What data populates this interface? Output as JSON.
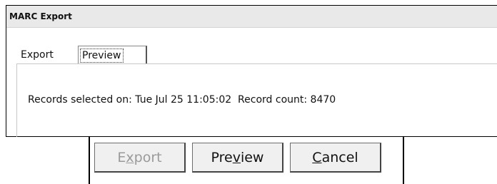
{
  "window": {
    "title": "MARC Export"
  },
  "tabs": [
    {
      "label": "Export",
      "selected": false
    },
    {
      "label": "Preview",
      "selected": true
    }
  ],
  "preview": {
    "selected_label": "Records selected on:",
    "selected_value": "Tue Jul 25 11:05:02",
    "count_label": "Record count:",
    "count_value": "8470"
  },
  "buttons": {
    "export": {
      "pre": "E",
      "mnemonic": "x",
      "post": "port",
      "enabled": false
    },
    "preview": {
      "pre": "Pre",
      "mnemonic": "v",
      "post": "iew",
      "enabled": true
    },
    "cancel": {
      "pre": "",
      "mnemonic": "C",
      "post": "ancel",
      "enabled": true
    }
  },
  "colors": {
    "titlebar": "#e9e9e9",
    "disabled_text": "#9a9a9a",
    "button_face": "#f0f0f0"
  }
}
